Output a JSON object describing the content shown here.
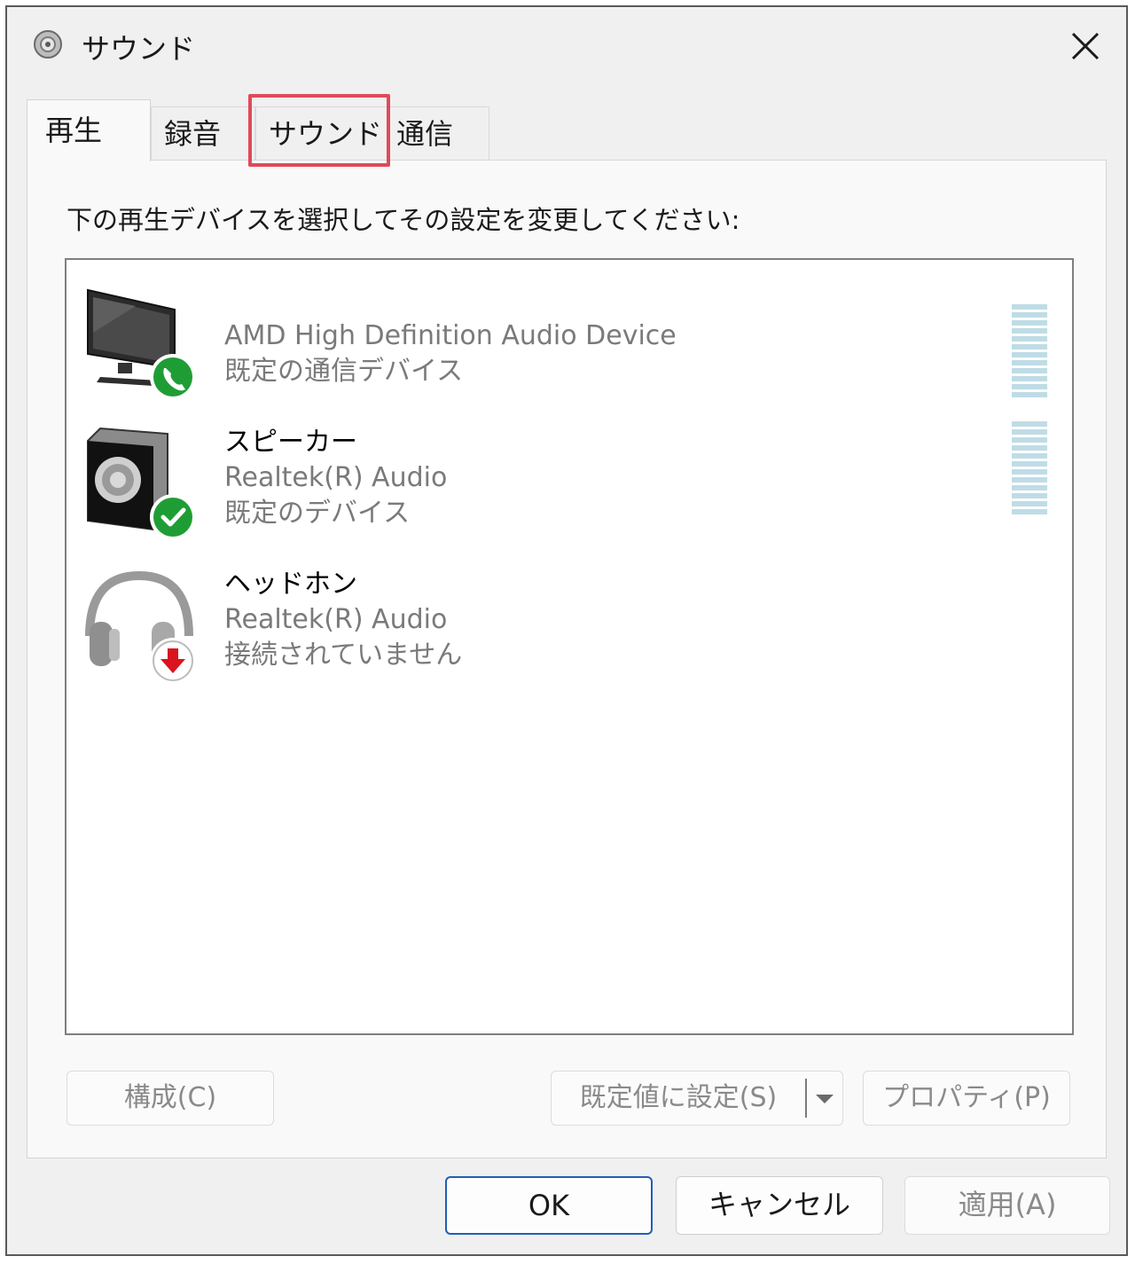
{
  "window": {
    "title": "サウンド",
    "close_icon": "close-icon",
    "title_icon": "speaker-icon"
  },
  "tabs": [
    {
      "label": "再生",
      "active": true
    },
    {
      "label": "録音",
      "active": false
    },
    {
      "label": "サウンド",
      "active": false,
      "highlighted": true
    },
    {
      "label": "通信",
      "active": false
    }
  ],
  "instruction": "下の再生デバイスを選択してその設定を変更してください:",
  "devices": [
    {
      "lines": [
        "AMD High Definition Audio Device",
        "既定の通信デバイス"
      ],
      "icon": "monitor-icon",
      "badge": "phone-icon",
      "badge_color": "#1f9d35",
      "disabled": true
    },
    {
      "name": "スピーカー",
      "lines": [
        "Realtek(R) Audio",
        "既定のデバイス"
      ],
      "icon": "speaker-icon",
      "badge": "check-icon",
      "badge_color": "#1f9d35"
    },
    {
      "name": "ヘッドホン",
      "lines": [
        "Realtek(R) Audio",
        "接続されていません"
      ],
      "icon": "headphones-icon",
      "badge": "down-arrow-icon",
      "badge_color": "#d9141e"
    }
  ],
  "buttons": {
    "configure": "構成(C)",
    "set_default": "既定値に設定(S)",
    "properties": "プロパティ(P)",
    "ok": "OK",
    "cancel": "キャンセル",
    "apply": "適用(A)"
  },
  "colors": {
    "highlight": "#e04a5a",
    "ok_border": "#1f5fb4",
    "meter": "#bfdce6"
  }
}
